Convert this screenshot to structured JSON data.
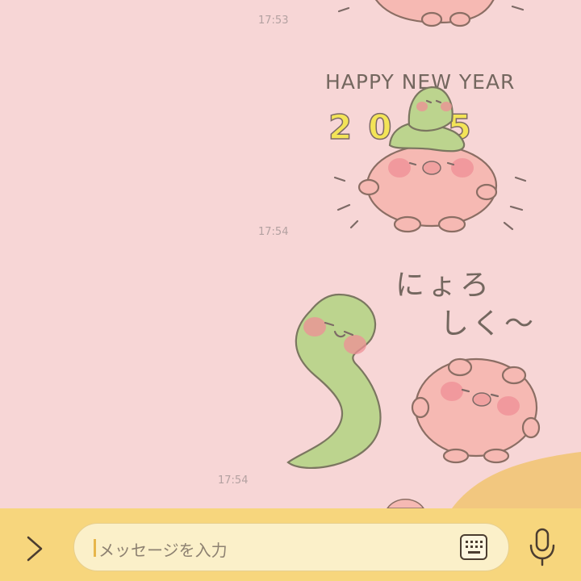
{
  "chat": {
    "timestamps": [
      "17:53",
      "17:54",
      "17:54"
    ],
    "sticker_texts": {
      "happy_new_year": "HAPPY NEW YEAR",
      "year": "2025",
      "greeting_line1": "にょろ",
      "greeting_line2": "しく〜"
    }
  },
  "input": {
    "placeholder": "メッセージを入力"
  },
  "icons": {
    "expand": "chevron-right-icon",
    "keyboard": "keyboard-icon",
    "mic": "microphone-icon"
  },
  "colors": {
    "chat_background": "#f7d6d6",
    "input_bar": "#f7d67d",
    "input_field": "#fbf0c9"
  }
}
